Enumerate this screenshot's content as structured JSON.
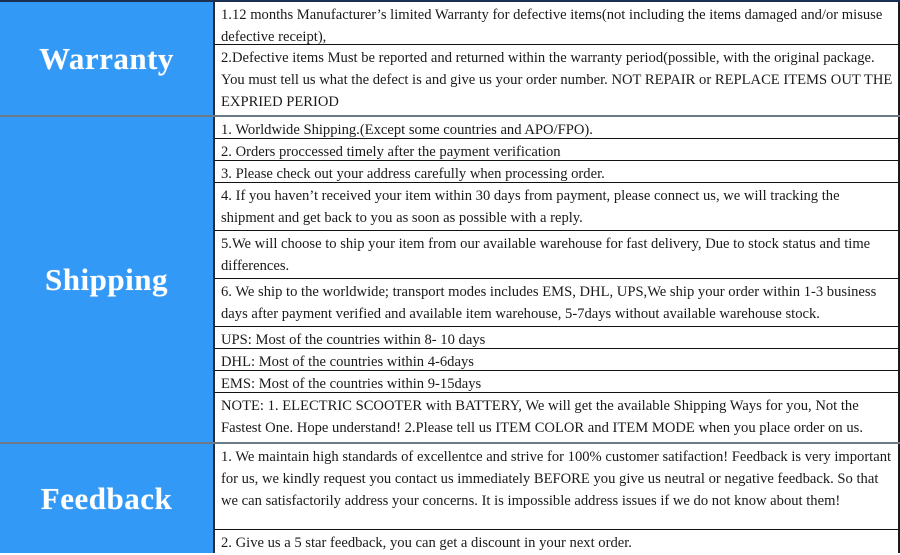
{
  "theme": {
    "accent_blue": "#3399f6",
    "label_text_color": "#ffffff",
    "body_text_color": "#1a1a1a",
    "border_color": "#111111"
  },
  "sections": [
    {
      "label": "Warranty",
      "rows": [
        "1.12 months Manufacturer’s limited Warranty for defective items(not including the items damaged and/or misuse defective receipt),",
        "2.Defective items Must be reported and returned within the warranty period(possible, with the original package. You must tell us what the defect is and give us your order number. NOT REPAIR or REPLACE ITEMS OUT THE EXPRIED PERIOD"
      ]
    },
    {
      "label": "Shipping",
      "rows": [
        "1. Worldwide Shipping.(Except some countries and APO/FPO).",
        "2. Orders proccessed timely after the payment verification",
        "3. Please check out your address carefully when processing order.",
        "4. If you haven’t received your item within 30 days from payment, please connect us, we will tracking the shipment and get back to you as soon as possible with a reply.",
        "5.We will choose to ship your item from our available warehouse for fast delivery, Due to stock status and time differences.",
        "6. We ship to the worldwide; transport modes includes EMS, DHL, UPS,We ship your order within 1-3 business days after payment verified and available item warehouse, 5-7days without available warehouse stock.",
        "UPS: Most of the countries within 8- 10 days",
        "DHL: Most of the countries within 4-6days",
        "EMS: Most of the countries within 9-15days",
        "NOTE: 1. ELECTRIC SCOOTER with BATTERY, We will get the available Shipping Ways for you, Not the Fastest One. Hope understand! 2.Please tell us ITEM COLOR and ITEM MODE when you place order on us."
      ]
    },
    {
      "label": "Feedback",
      "rows": [
        "1. We maintain high standards of excellentce and strive for 100% customer satifaction! Feedback is very important for us, we kindly request you contact us immediately BEFORE you give us neutral or negative feedback. So that we can satisfactorily address your concerns. It is impossible address issues if we do not know about them!",
        "2. Give us a 5 star feedback, you can get a discount in your next order."
      ]
    }
  ]
}
